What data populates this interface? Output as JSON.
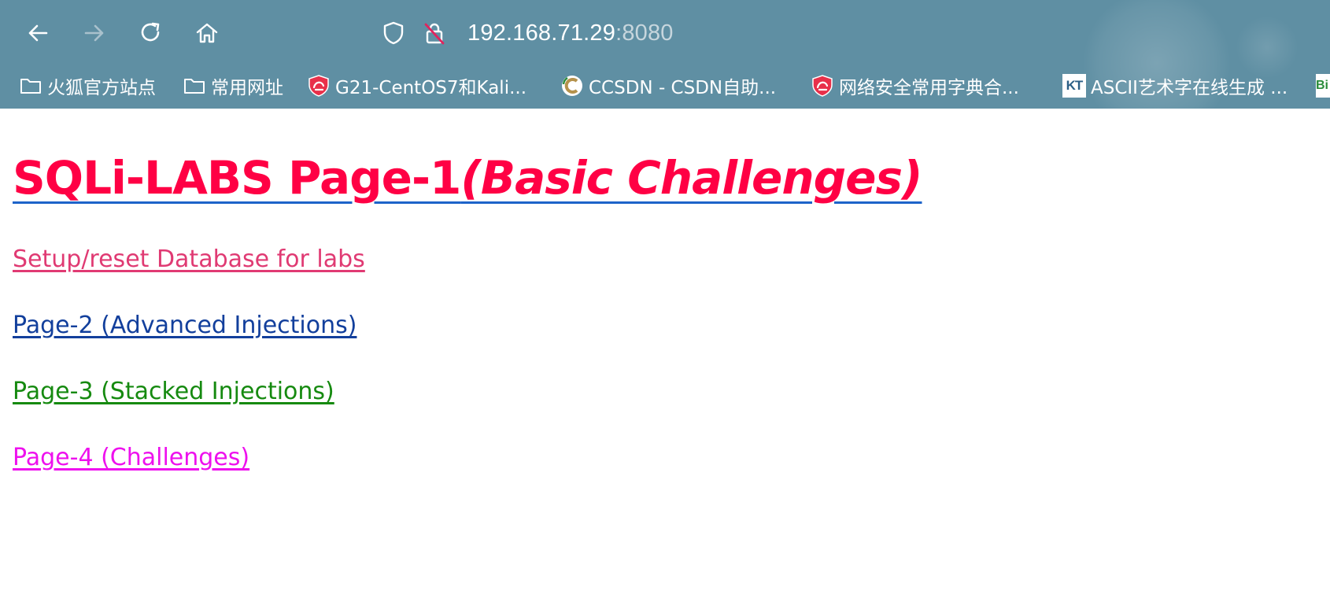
{
  "browser": {
    "url_host": "192.168.71.29",
    "url_port": ":8080",
    "bookmarks": [
      {
        "label": "火狐官方站点",
        "icon": "folder-icon"
      },
      {
        "label": "常用网址",
        "icon": "folder-icon"
      },
      {
        "label": "G21-CentOS7和Kali...",
        "icon": "shield-logo-icon"
      },
      {
        "label": "CCSDN - CSDN自助...",
        "icon": "c-logo-icon"
      },
      {
        "label": "网络安全常用字典合...",
        "icon": "shield-logo-icon"
      },
      {
        "label": "ASCII艺术字在线生成 ...",
        "icon": "kt-logo-icon",
        "icon_text": "KT"
      },
      {
        "label": "",
        "icon": "bi-logo-icon",
        "icon_text": "Bi"
      }
    ]
  },
  "page": {
    "title_main": "SQLi-LABS Page-1",
    "title_sub": "(Basic Challenges)",
    "links": {
      "setup": "Setup/reset Database for labs",
      "page2": "Page-2 (Advanced Injections)",
      "page3": "Page-3 (Stacked Injections)",
      "page4": "Page-4 (Challenges)"
    }
  },
  "colors": {
    "chrome_bg": "#5f8fa3",
    "title": "#ff0044",
    "title_underline": "#1d63c9",
    "setup_link": "#e03a73",
    "page2_link": "#123f9c",
    "page3_link": "#168a10",
    "page4_link": "#ee10ee"
  }
}
